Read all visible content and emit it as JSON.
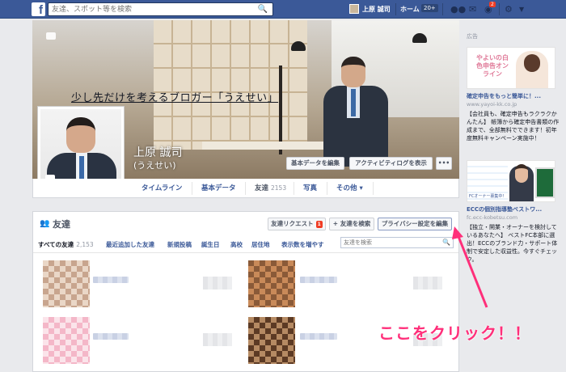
{
  "topbar": {
    "logo": "f",
    "search_placeholder": "友達、スポット等を検索",
    "user_name": "上原 誠司",
    "home_label": "ホーム",
    "home_badge": "20+",
    "notification_badge": "2"
  },
  "cover": {
    "title": "少し先だけを考えるブロガー「うえせい」",
    "name": "上原 誠司",
    "nickname": "(うえせい)",
    "edit_basic_button": "基本データを編集",
    "activity_log_button": "アクティビティログを表示",
    "more_button": "•••"
  },
  "nav": {
    "timeline": "タイムライン",
    "basic_data": "基本データ",
    "friends": "友達",
    "friends_count": "2153",
    "photos": "写真",
    "more": "その他 ▾"
  },
  "friends_section": {
    "title": "友達",
    "friend_request_button": "友達リクエスト",
    "friend_request_badge": "1",
    "find_friends_button": "+ 友達を検索",
    "privacy_button": "プライバシー設定を編集",
    "search_placeholder": "友達を検索",
    "tabs": [
      {
        "label": "すべての友達",
        "count": "2,153"
      },
      {
        "label": "最近追加した友達"
      },
      {
        "label": "新規投稿"
      },
      {
        "label": "誕生日"
      },
      {
        "label": "高校"
      },
      {
        "label": "居住地"
      },
      {
        "label": "表示数を増やす"
      }
    ]
  },
  "ads": {
    "heading": "広告",
    "ad1": {
      "image_text": "やよいの白色申告オンライン",
      "title": "確定申告をもっと簡単に！...",
      "url": "www.yayoi-kk.co.jp",
      "body": "【会社員も、確定申告もラクラクかんたん】 帳簿から確定申告書類の作成まで、全部無料でできます！初年度無料キャンペーン実施中！"
    },
    "ad2": {
      "image_text": "FCオーナー募集中!",
      "title": "ECCの個別指導塾ベストワ...",
      "url": "fc.ecc-kobetsu.com",
      "body": "【独立・開業・オーナーを検討しているあなたへ】 ベストFC本部に選出！ECCのブランド力・サポート体制で安定した収益性。今すぐチェック。"
    }
  },
  "annotation": {
    "callout": "ここをクリック！！",
    "color": "#ff2f7a"
  },
  "colors": {
    "brand": "#3b5998",
    "background": "#e9eaed",
    "badge": "#f03d25"
  }
}
